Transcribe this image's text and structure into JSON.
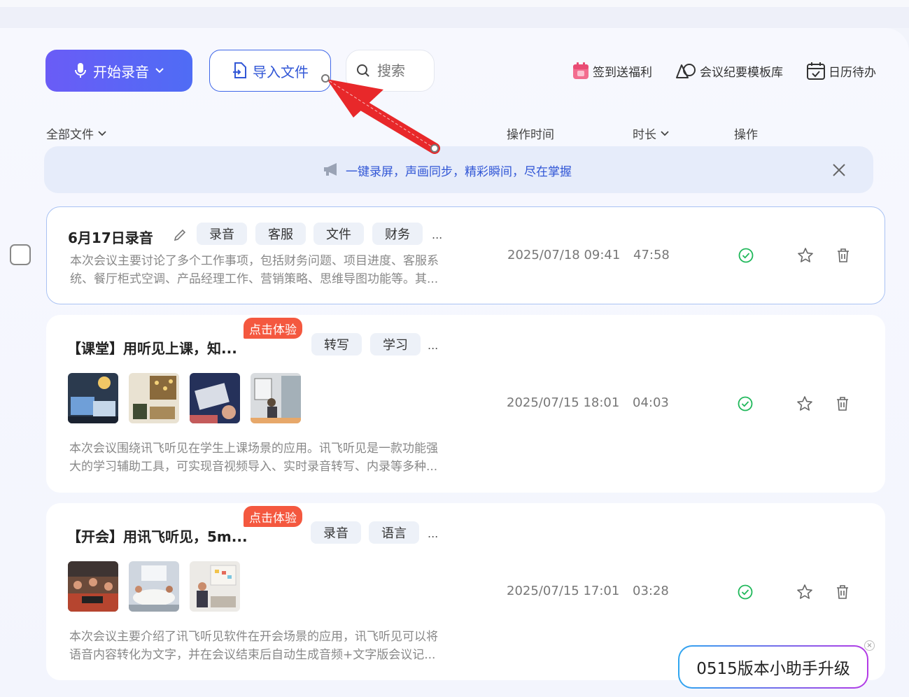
{
  "toolbar": {
    "record_label": "开始录音",
    "import_label": "导入文件",
    "search_placeholder": "搜索",
    "links": [
      "签到送福利",
      "会议纪要模板库",
      "日历待办"
    ]
  },
  "list_header": {
    "filter_label": "全部文件",
    "time_label": "操作时间",
    "duration_label": "时长",
    "action_label": "操作"
  },
  "banner": {
    "text": "一键录屏，声画同步，精彩瞬间，尽在掌握"
  },
  "rows": [
    {
      "title": "6月17日录音",
      "tags": [
        "录音",
        "客服",
        "文件",
        "财务"
      ],
      "more": "...",
      "summary_line1": "本次会议主要讨论了多个工作事项，包括财务问题、项目进度、客服系",
      "summary_line2": "统、餐厅柜式空调、产品经理工作、营销策略、思维导图功能等。其...",
      "time": "2025/07/18 09:41",
      "duration": "47:58"
    },
    {
      "title": "【课堂】用听见上课，知...",
      "badge": "点击体验",
      "tags": [
        "转写",
        "学习"
      ],
      "more": "...",
      "summary_line1": "本次会议围绕讯飞听见在学生上课场景的应用。讯飞听见是一款功能强",
      "summary_line2": "大的学习辅助工具，可实现音视频导入、实时录音转写、内录等多种...",
      "time": "2025/07/15 18:01",
      "duration": "04:03"
    },
    {
      "title": "【开会】用讯飞听见，5m...",
      "badge": "点击体验",
      "tags": [
        "录音",
        "语言"
      ],
      "more": "...",
      "summary_line1": "本次会议主要介绍了讯飞听见软件在开会场景的应用，讯飞听见可以将",
      "summary_line2": "语音内容转化为文字，并在会议结束后自动生成音频+文字版会议记...",
      "time": "2025/07/15 17:01",
      "duration": "03:28"
    }
  ],
  "assistant": {
    "label": "0515版本小助手升级",
    "close": "×"
  },
  "colors": {
    "accent": "#4f6cf5",
    "badge": "#f4583f",
    "success": "#1fb85a",
    "annotation": "#ee2a24"
  }
}
